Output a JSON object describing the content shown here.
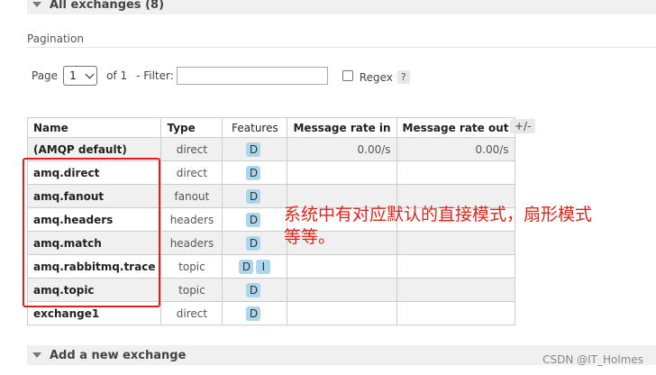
{
  "sections": {
    "all_exchanges": "All exchanges (8)",
    "add_exchange": "Add a new exchange"
  },
  "pagination": {
    "label": "Pagination",
    "page_label": "Page",
    "page_value": "1",
    "of_label": "of 1",
    "filter_label": "- Filter:",
    "filter_value": "",
    "regex_label": "Regex",
    "regex_checked": false,
    "help": "?"
  },
  "table": {
    "columns": [
      "Name",
      "Type",
      "Features",
      "Message rate in",
      "Message rate out"
    ],
    "toggle_columns": "+/-",
    "rows": [
      {
        "name": "(AMQP default)",
        "type": "direct",
        "features": [
          "D"
        ],
        "rate_in": "0.00/s",
        "rate_out": "0.00/s"
      },
      {
        "name": "amq.direct",
        "type": "direct",
        "features": [
          "D"
        ],
        "rate_in": "",
        "rate_out": ""
      },
      {
        "name": "amq.fanout",
        "type": "fanout",
        "features": [
          "D"
        ],
        "rate_in": "",
        "rate_out": ""
      },
      {
        "name": "amq.headers",
        "type": "headers",
        "features": [
          "D"
        ],
        "rate_in": "",
        "rate_out": ""
      },
      {
        "name": "amq.match",
        "type": "headers",
        "features": [
          "D"
        ],
        "rate_in": "",
        "rate_out": ""
      },
      {
        "name": "amq.rabbitmq.trace",
        "type": "topic",
        "features": [
          "D",
          "I"
        ],
        "rate_in": "",
        "rate_out": ""
      },
      {
        "name": "amq.topic",
        "type": "topic",
        "features": [
          "D"
        ],
        "rate_in": "",
        "rate_out": ""
      },
      {
        "name": "exchange1",
        "type": "direct",
        "features": [
          "D"
        ],
        "rate_in": "",
        "rate_out": ""
      }
    ]
  },
  "annotation": {
    "line1": "系统中有对应默认的直接模式，扇形模式",
    "line2": "等等。",
    "color": "#e0251b"
  },
  "watermark": "CSDN @IT_Holmes",
  "colors": {
    "badge_bg": "#aad7ee",
    "row_alt": "#f0f0f0",
    "highlight_box": "#e02020"
  }
}
